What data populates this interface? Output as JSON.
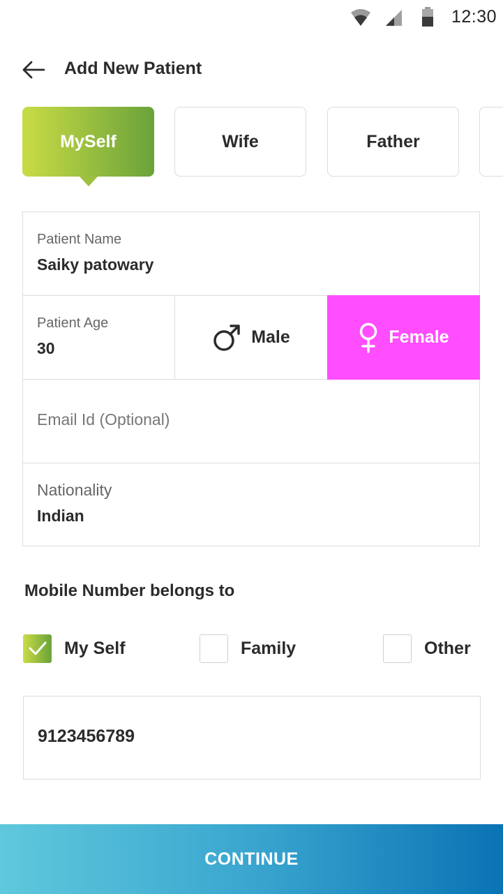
{
  "status_bar": {
    "time": "12:30"
  },
  "header": {
    "title": "Add New Patient"
  },
  "relation_tabs": [
    {
      "label": "MySelf",
      "selected": true
    },
    {
      "label": "Wife",
      "selected": false
    },
    {
      "label": "Father",
      "selected": false
    }
  ],
  "form": {
    "patient_name": {
      "label": "Patient Name",
      "value": "Saiky patowary"
    },
    "patient_age": {
      "label": "Patient Age",
      "value": "30"
    },
    "gender": {
      "male_label": "Male",
      "female_label": "Female",
      "selected": "Female"
    },
    "email": {
      "placeholder": "Email Id (Optional)"
    },
    "nationality": {
      "label": "Nationality",
      "value": "Indian"
    }
  },
  "mobile": {
    "heading": "Mobile Number belongs to",
    "options": [
      {
        "label": "My Self",
        "checked": true
      },
      {
        "label": "Family",
        "checked": false
      },
      {
        "label": "Other",
        "checked": false
      }
    ],
    "number": "9123456789"
  },
  "continue_label": "CONTINUE",
  "colors": {
    "accent_green_start": "#c9dc46",
    "accent_green_end": "#6aa23a",
    "female_selected": "#ff4dff",
    "button_gradient_start": "#5fc8dc",
    "button_gradient_end": "#0a73b4"
  },
  "icons": [
    "wifi-icon",
    "signal-icon",
    "battery-icon",
    "back-arrow-icon",
    "male-icon",
    "female-icon",
    "checkmark-icon"
  ]
}
